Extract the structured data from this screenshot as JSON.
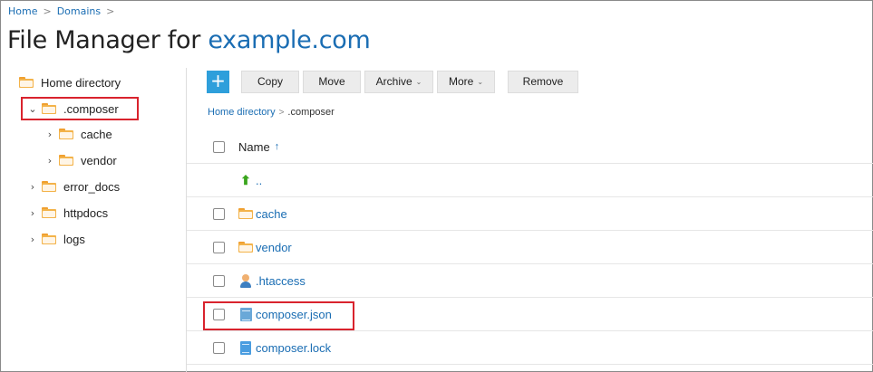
{
  "breadcrumb": {
    "home": "Home",
    "domains": "Domains",
    "sep": ">"
  },
  "title": {
    "prefix": "File Manager for ",
    "domain": "example.com"
  },
  "sidebar": {
    "items": [
      {
        "label": "Home directory",
        "chevron": "",
        "expanded": false
      },
      {
        "label": ".composer",
        "chevron": "⌄",
        "expanded": true,
        "highlighted": true
      },
      {
        "label": "cache",
        "chevron": "›"
      },
      {
        "label": "vendor",
        "chevron": "›"
      },
      {
        "label": "error_docs",
        "chevron": "›"
      },
      {
        "label": "httpdocs",
        "chevron": "›"
      },
      {
        "label": "logs",
        "chevron": "›"
      }
    ]
  },
  "toolbar": {
    "add_label": "+",
    "copy": "Copy",
    "move": "Move",
    "archive": "Archive",
    "more": "More",
    "remove": "Remove",
    "caret": "⌄"
  },
  "path": {
    "home": "Home directory",
    "sep": ">",
    "current": ".composer"
  },
  "table": {
    "header": {
      "name": "Name",
      "sort": "↑"
    },
    "rows": [
      {
        "name": "..",
        "icon": "up-arrow-icon",
        "checkbox": false
      },
      {
        "name": "cache",
        "icon": "folder-icon",
        "checkbox": true
      },
      {
        "name": "vendor",
        "icon": "folder-icon",
        "checkbox": true
      },
      {
        "name": ".htaccess",
        "icon": "user-file-icon",
        "checkbox": true
      },
      {
        "name": "composer.json",
        "icon": "json-file-icon",
        "checkbox": true,
        "highlighted": true
      },
      {
        "name": "composer.lock",
        "icon": "document-icon",
        "checkbox": true
      }
    ]
  },
  "colors": {
    "accent": "#1a6db3",
    "add_button": "#2e9fdb",
    "highlight": "#d9232d",
    "folder": "#f3b34a"
  }
}
